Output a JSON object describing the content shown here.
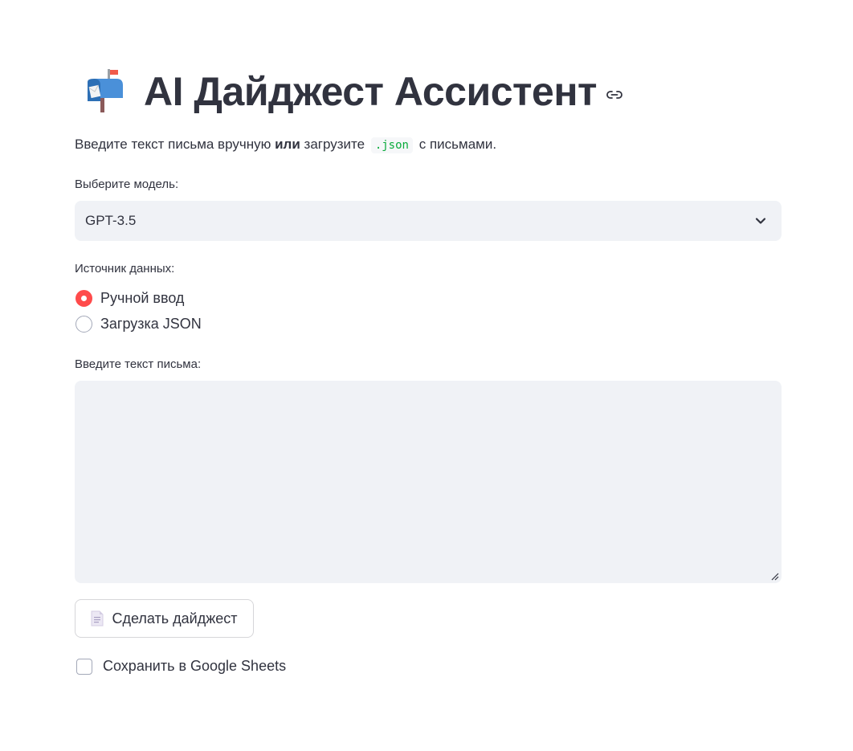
{
  "header": {
    "icon": "mailbox-with-flag-icon",
    "title": "AI Дайджест Ассистент",
    "anchor_icon": "link-icon"
  },
  "intro": {
    "part1": "Введите текст письма вручную",
    "bold": "или",
    "part2": "загрузите",
    "code": ".json",
    "part3": "с письмами."
  },
  "model_select": {
    "label": "Выберите модель:",
    "value": "GPT-3.5",
    "icon": "chevron-down-icon"
  },
  "source": {
    "label": "Источник данных:",
    "options": [
      {
        "label": "Ручной ввод",
        "selected": true
      },
      {
        "label": "Загрузка JSON",
        "selected": false
      }
    ]
  },
  "email_input": {
    "label": "Введите текст письма:",
    "value": ""
  },
  "digest_button": {
    "label": "Сделать дайджест",
    "icon": "page-facing-up-icon"
  },
  "save_checkbox": {
    "label": "Сохранить в Google Sheets",
    "checked": false
  },
  "colors": {
    "text": "#31333f",
    "accent": "#ff4b4b",
    "input_bg": "#f0f2f6",
    "code": "#09ab3b"
  }
}
